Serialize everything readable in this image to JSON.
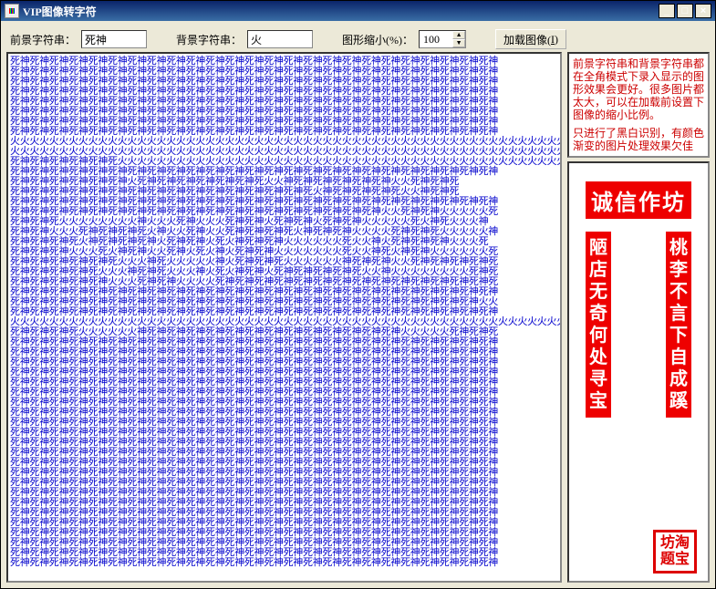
{
  "window": {
    "title": "VIP图像转字符"
  },
  "toolbar": {
    "fg_label": "前景字符串：",
    "fg_value": "死神",
    "bg_label": "背景字符串：",
    "bg_value": "火",
    "scale_label": "图形缩小(%)：",
    "scale_value": "100",
    "load_label": "加载图像(",
    "load_key": "I",
    "load_label2": ")"
  },
  "tip": {
    "p1": "前景字符串和背景字符串都在全角模式下录入显示的图形效果会更好。很多图片都太大，可以在加载前设置下图像的缩小比例。",
    "p2": "只进行了黑白识别，有颜色渐变的图片处理效果欠佳"
  },
  "banner": {
    "horizontal": "诚信作坊",
    "left": "陋店无奇何处寻宝",
    "right": "桃李不言下自成蹊",
    "seal": "坊淘题宝"
  },
  "art_chars": {
    "fg": "死神",
    "bg": "火"
  },
  "art_rows": [
    "FFFFFFFFFFFFFFFFFFFFFFFFFFFFFFFFFFFFFFFFFFFFFFFFFF",
    "FFFFFFFFFFFFFFFFFFFFFFFFFFFFFFFFFFFFFFFFFFFFFFFFFF",
    "FFFFFFFFFFFFFFFFFFFFFFFFFFFFFFFFFFFFFFFFFFFFFFFFFF",
    "FFFFFFFFFFFFFFFFFFFFFFFFFFFFFFFFFFFFFFFFFFFFFFFFFF",
    "FFFFFFFFFFFFFFFFFFFFFFFFFFFFFFFFFFFFFFFFFFFFFFFFFF",
    "FFFFFFFFFFFFFFFFFFFFFFFFFFFFFFFFFFFFFFFFFFFFFFFFFF",
    "FFFFFFFFFFFFFFFFFFFFFFFFFFFFFFFFFFFFFFFFFFFFFFFFFF",
    "FFFFFFFFFFFFFFFFFFFFFFFFFFFFFFFFFFFFFFFFFFFFFFFFFF",
    "bbbbbbbbbbbbbbbbbbbbbbbbbbbbbbbbbbbbbbbbbbbbbbbbbbbbbbbbbbbbbbbbbbbbbbbbbbbbbbbbbbbbbbbbbbbbbbbbbbbb",
    "bbbbbbbbbbbbbbbbbbbbbbbbbbbbbbbbbbbbbbbbbbbbbbbbbbbbbbbbbbbbbbbbbbbbbbbbbbbbbbbbbbbbbbbbbbbbbbbbbbbb",
    "FFFFFFFFFFFbbbbbbbbbbbbbbbbbbbbbbbbbbbbbbbbbbbbbbbbbbbbbbbbbbbbbbbbbbbbbbbbbbbbbbbbbbbbbbFF",
    "FFFFFFFFFFFFFFFFFFFFFFFFFFFFFFFFFFFFFFFFFFFFFFFFFF",
    "FFFFFFFFFFFFbFFFFFFFFFFFFFbbFFFFFFFFFFFbbFFFFF",
    "FFFFFFFFFFFFFFFFFFFFFFFFFFFFFFFbFFFFFFFFbbFFFF",
    "FFFFFFFFFFFFFFFFFFFFFFFFFFFFFFFFFFFFFFFFFFFFFFFFFF",
    "FFFFFFFFFFFFFFFFFFFFFFFFFFFFFFFFFFFFFFbbFFFFbbbbbF",
    "FFFFFbbbbbbbbFbbbFFbbbFFFFbFFFFbFFFFbbbbbFbFFbbbF",
    "FFFFbbbFFFFFFFbFbbFFbbFFFFFFFbFFFFFbbbbFFFFFbbbbbF",
    "FFFFFFFbFFFFFFFbFFFFbFbFFFFFbbbbbbFbbFbFFFFFFbbbF",
    "FFFFFFbbbFbFFFbbFFbFbFbFFFFbbbbbbbFbbFFbFFFbbbbbbF",
    "FFFFFFFFFFFbbbFFbbbbbFbFFFFFbbbbbbFFFFFbbFFFFFFFFF",
    "FFFFFFFFFbbbFFFFbbbFbFbFFFbFFFFFFFFFbbFbbbbbbbbFFF",
    "FFFFFFFFFFbbbFFFFbbbbFFFFFFFFFFFFFFFFFFFFFFFFFFFFF",
    "FFFFFFFFFFFFFFFFFFFFFFFFFFFFFFFFFFFFFFFFFFFFFFFFFF",
    "FFFFFFFFFFFFFFFFFFFFFFFFFFFFFFFFFFFFFFFFFFFFFFFFbb",
    "FFFFFFFFFFFFFFFFFFFFFFFFFFFFFFFFFFFFFFFFFFFFFFFFFF",
    "bbbbbbbbbbbbbbbbbbbbbbbbbbbbbbbbbbbbbbbbbbbbbbbbbbbbbbbbbbbbbbbbbbbbbbbbbbbbbbbbbbbbbbbbbbbbbbbbbbbb",
    "FFFFFFFbbbbbbFFFFFFFFFFFFFFFFFFFFFFFFFFFbbbbbFFFFF",
    "FFFFFFFFFFFFFFFFFFFFFFFFFFFFFFFFFFFFFFFFFFFFFFFFFF",
    "FFFFFFFFFFFFFFFFFFFFFFFFFFFFFFFFFFFFFFFFFFFFFFFFFF",
    "FFFFFFFFFFFFFFFFFFFFFFFFFFFFFFFFFFFFFFFFFFFFFFFFFF",
    "FFFFFFFFFFFFFFFFFFFFFFFFFFFFFFFFFFFFFFFFFFFFFFFFFF",
    "FFFFFFFFFFFFFFFFFFFFFFFFFFFFFFFFFFFFFFFFFFFFFFFFFF",
    "FFFFFFFFFFFFFFFFFFFFFFFFFFFFFFFFFFFFFFFFFFFFFFFFFF",
    "FFFFFFFFFFFFFFFFFFFFFFFFFFFFFFFFFFFFFFFFFFFFFFFFFF",
    "FFFFFFFFFFFFFFFFFFFFFFFFFFFFFFFFFFFFFFFFFFFFFFFFFF",
    "FFFFFFFFFFFFFFFFFFFFFFFFFFFFFFFFFFFFFFFFFFFFFFFFFF",
    "FFFFFFFFFFFFFFFFFFFFFFFFFFFFFFFFFFFFFFFFFFFFFFFFFF",
    "FFFFFFFFFFFFFFFFFFFFFFFFFFFFFFFFFFFFFFFFFFFFFFFFFF",
    "FFFFFFFFFFFFFFFFFFFFFFFFFFFFFFFFFFFFFFFFFFFFFFFFFF",
    "FFFFFFFFFFFFFFFFFFFFFFFFFFFFFFFFFFFFFFFFFFFFFFFFFF",
    "FFFFFFFFFFFFFFFFFFFFFFFFFFFFFFFFFFFFFFFFFFFFFFFFFF",
    "FFFFFFFFFFFFFFFFFFFFFFFFFFFFFFFFFFFFFFFFFFFFFFFFFF",
    "FFFFFFFFFFFFFFFFFFFFFFFFFFFFFFFFFFFFFFFFFFFFFFFFFF",
    "FFFFFFFFFFFFFFFFFFFFFFFFFFFFFFFFFFFFFFFFFFFFFFFFFF",
    "FFFFFFFFFFFFFFFFFFFFFFFFFFFFFFFFFFFFFFFFFFFFFFFFFF",
    "FFFFFFFFFFFFFFFFFFFFFFFFFFFFFFFFFFFFFFFFFFFFFFFFFF",
    "FFFFFFFFFFFFFFFFFFFFFFFFFFFFFFFFFFFFFFFFFFFFFFFFFF",
    "FFFFFFFFFFFFFFFFFFFFFFFFFFFFFFFFFFFFFFFFFFFFFFFFFF",
    "FFFFFFFFFFFFFFFFFFFFFFFFFFFFFFFFFFFFFFFFFFFFFFFFFF",
    "FFFFFFFFFFFFFFFFFFFFFFFFFFFFFFFFFFFFFFFFFFFFFFFFFF"
  ]
}
